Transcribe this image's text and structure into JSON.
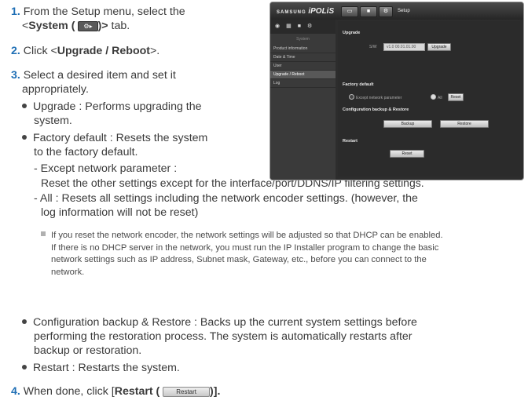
{
  "steps": {
    "s1": {
      "num": "1.",
      "line1": "From the Setup menu, select the",
      "pre": "<",
      "bold": "System (",
      "post": ")>",
      "tail": "tab.",
      "icon_label": ""
    },
    "s2": {
      "num": "2.",
      "pre": "Click <",
      "bold": "Upgrade / Reboot",
      "post": ">."
    },
    "s3": {
      "num": "3.",
      "line1": "Select a desired item and set it",
      "line2": "appropriately."
    },
    "b_upgrade": {
      "l1": "Upgrade : Performs upgrading the",
      "l2": "system."
    },
    "b_factory": {
      "l1": "Factory default : Resets the system",
      "l2": "to the factory default."
    },
    "d_except": {
      "l1": "- Except network parameter :",
      "l2": "Reset the other settings except for the interface/port/DDNS/IP filtering settings."
    },
    "d_all": {
      "l1": "- All : Resets all settings including the network encoder settings. (however, the",
      "l2": "log information will not be reset)"
    },
    "note": {
      "l1": "If you reset the network encoder, the network settings will be adjusted so that DHCP can be enabled.",
      "l2": "If there is no DHCP server in the network, you must run the IP Installer program to change the basic",
      "l3": "network settings such as IP address, Subnet mask, Gateway, etc., before you can connect to the",
      "l4": "network."
    },
    "b_config": {
      "l1": "Configuration backup & Restore : Backs up the current system settings before",
      "l2": "performing the restoration process. The system is automatically restarts after",
      "l3": "backup or restoration."
    },
    "b_restart": {
      "l1": "Restart : Restarts the system."
    },
    "s4": {
      "num": "4.",
      "pre": "When done, click [",
      "bold": "Restart (",
      "post": ")].",
      "btn": "Restart"
    }
  },
  "screenshot": {
    "brand": "SAMSUNG",
    "logo": "iPOLiS",
    "title": "Setup",
    "sidebar_head": "System",
    "sidebar_items": [
      "Product information",
      "Date & Time",
      "User",
      "Upgrade / Reboot",
      "Log"
    ],
    "selected_index": 3,
    "upgrade": {
      "heading": "Upgrade",
      "sw_label": "S/W",
      "sw_value": "v1.0 00.01.01.00",
      "button": "Upgrade"
    },
    "factory": {
      "heading": "Factory default",
      "option_except": "Except network parameter",
      "option_all": "All",
      "button": "Reset"
    },
    "config": {
      "heading": "Configuration backup & Restore",
      "backup": "Backup",
      "restore": "Restore"
    },
    "restart": {
      "heading": "Restart",
      "button": "Reset"
    }
  }
}
